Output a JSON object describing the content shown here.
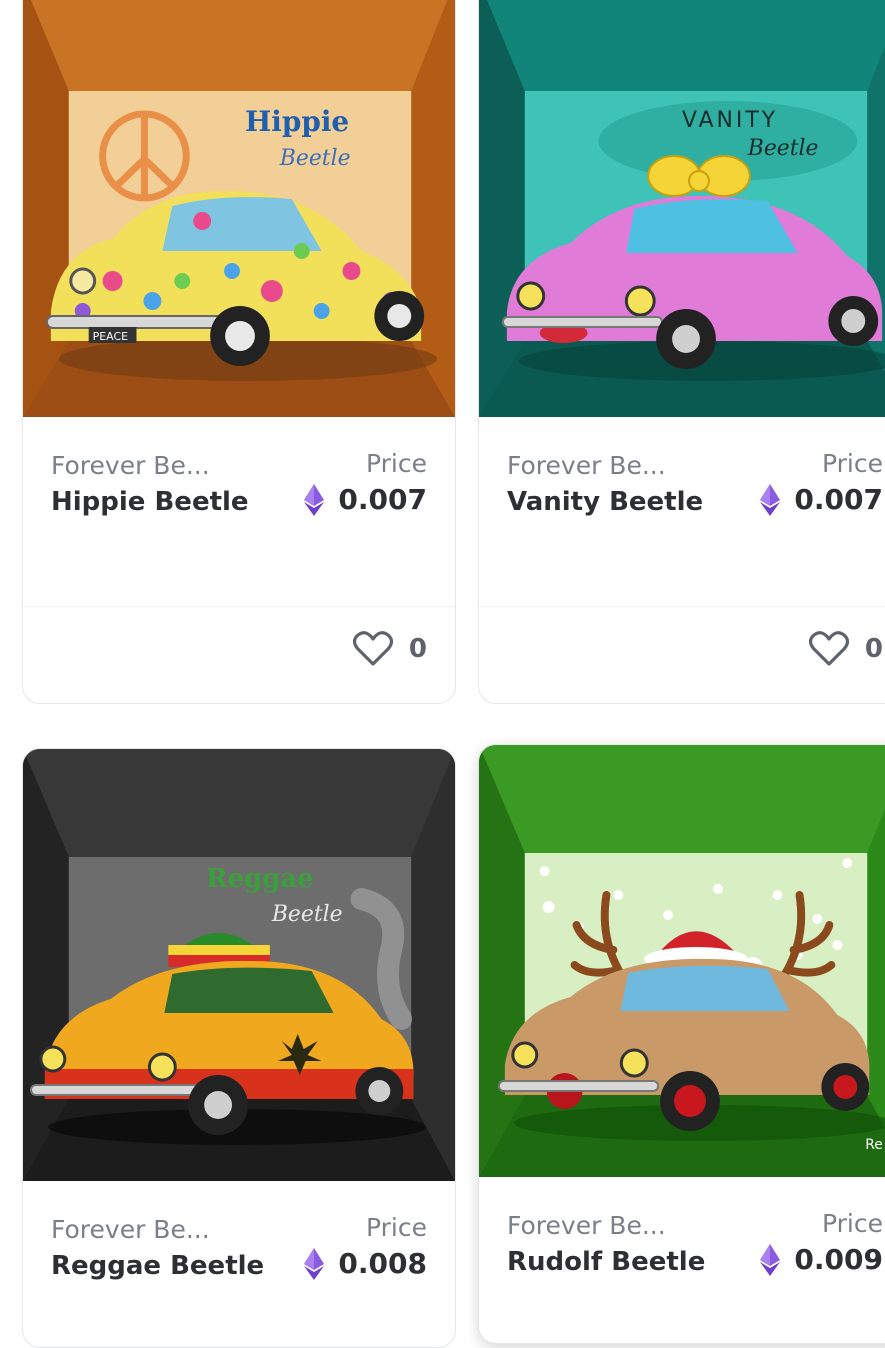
{
  "cards": [
    {
      "collection": "Forever Be...",
      "name": "Hippie Beetle",
      "price_label": "Price",
      "price": "0.007",
      "likes": "0",
      "art_title": "Hippie",
      "art_subtitle": "Beetle",
      "plate": "PEACE",
      "colors": {
        "box": "#c56a18",
        "wall": "#f2c48b",
        "car": "#f2e05a"
      }
    },
    {
      "collection": "Forever Be...",
      "name": "Vanity Beetle",
      "price_label": "Price",
      "price": "0.007",
      "likes": "0",
      "art_title": "VANITY",
      "art_subtitle": "Beetle",
      "colors": {
        "box": "#0f7d72",
        "wall": "#39c4b8",
        "car": "#e07bd8"
      }
    },
    {
      "collection": "Forever Be...",
      "name": "Reggae Beetle",
      "price_label": "Price",
      "price": "0.008",
      "art_title": "Reggae",
      "art_subtitle": "Beetle",
      "colors": {
        "box": "#2c2c2c",
        "wall": "#6b6b6b",
        "car": "#f0a81e"
      }
    },
    {
      "collection": "Forever Be...",
      "name": "Rudolf Beetle",
      "price_label": "Price",
      "price": "0.009",
      "art_credit": "Re",
      "colors": {
        "box": "#2f8a1c",
        "wall": "#d9f1c4",
        "car": "#c99a67"
      }
    }
  ],
  "icons": {
    "currency": "ethereum-icon",
    "like": "heart-icon"
  }
}
